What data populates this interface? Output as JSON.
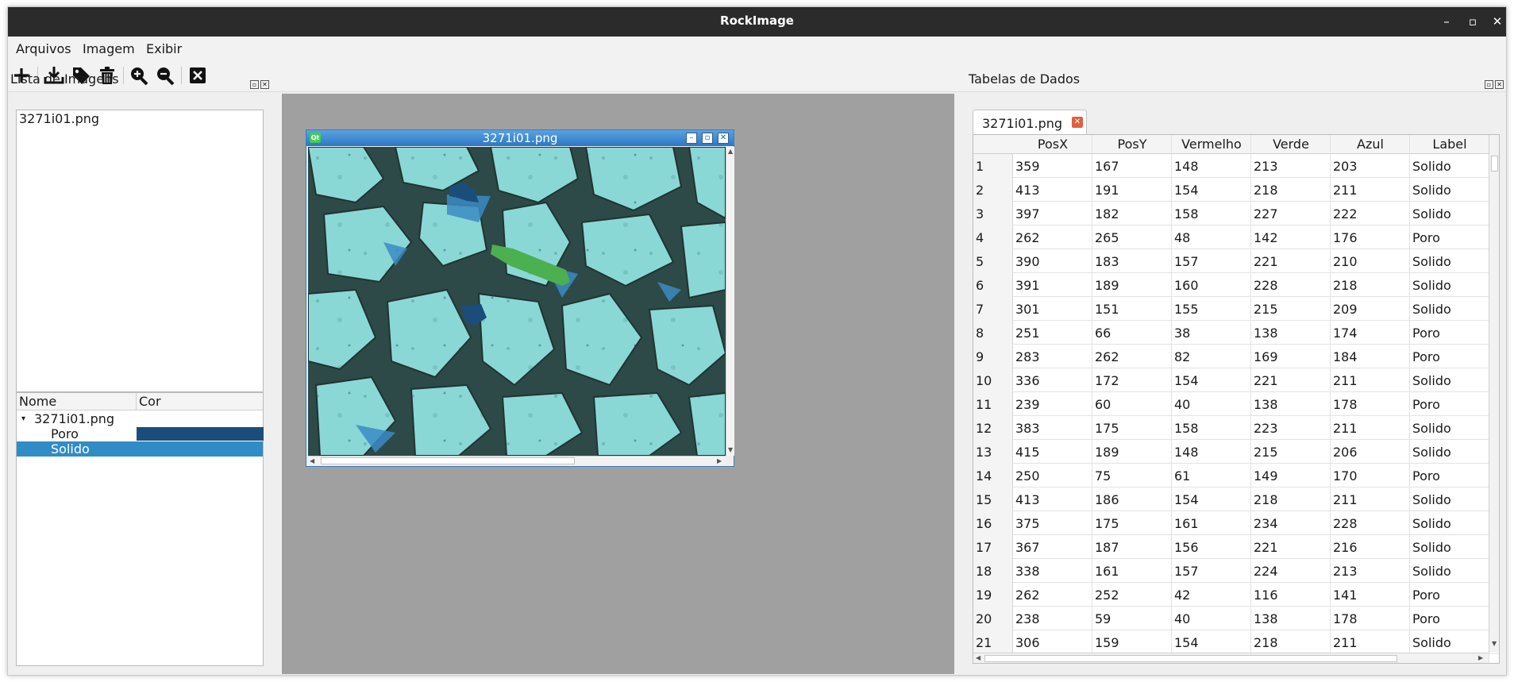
{
  "app": {
    "title": "RockImage",
    "window_controls": {
      "minimize": "–",
      "maximize": "▫",
      "close": "✕"
    }
  },
  "menu": [
    "Arquivos",
    "Imagem",
    "Exibir"
  ],
  "toolbar": {
    "icons": [
      "plus-icon",
      "download-icon",
      "tag-icon",
      "trash-icon",
      "zoom-in-icon",
      "zoom-out-icon",
      "close-icon"
    ]
  },
  "left_panel": {
    "title": "Lista de Imagens",
    "images": [
      "3271i01.png"
    ],
    "tree": {
      "columns": [
        "Nome",
        "Cor"
      ],
      "root": "3271i01.png",
      "children": [
        {
          "name": "Poro",
          "color": "#1a4d7a",
          "selected": false
        },
        {
          "name": "Solido",
          "color": "#308cc6",
          "selected": true
        }
      ]
    }
  },
  "image_window": {
    "title": "3271i01.png",
    "badge": "Qt",
    "annotation_colors": {
      "poro": "#1a4d7a",
      "solido": "#4caf50"
    }
  },
  "right_panel": {
    "title": "Tabelas de Dados",
    "tab": "3271i01.png",
    "columns": [
      "PosX",
      "PosY",
      "Vermelho",
      "Verde",
      "Azul",
      "Label"
    ],
    "rows": [
      [
        "1",
        "359",
        "167",
        "148",
        "213",
        "203",
        "Solido"
      ],
      [
        "2",
        "413",
        "191",
        "154",
        "218",
        "211",
        "Solido"
      ],
      [
        "3",
        "397",
        "182",
        "158",
        "227",
        "222",
        "Solido"
      ],
      [
        "4",
        "262",
        "265",
        "48",
        "142",
        "176",
        "Poro"
      ],
      [
        "5",
        "390",
        "183",
        "157",
        "221",
        "210",
        "Solido"
      ],
      [
        "6",
        "391",
        "189",
        "160",
        "228",
        "218",
        "Solido"
      ],
      [
        "7",
        "301",
        "151",
        "155",
        "215",
        "209",
        "Solido"
      ],
      [
        "8",
        "251",
        "66",
        "38",
        "138",
        "174",
        "Poro"
      ],
      [
        "9",
        "283",
        "262",
        "82",
        "169",
        "184",
        "Poro"
      ],
      [
        "10",
        "336",
        "172",
        "154",
        "221",
        "211",
        "Solido"
      ],
      [
        "11",
        "239",
        "60",
        "40",
        "138",
        "178",
        "Poro"
      ],
      [
        "12",
        "383",
        "175",
        "158",
        "223",
        "211",
        "Solido"
      ],
      [
        "13",
        "415",
        "189",
        "148",
        "215",
        "206",
        "Solido"
      ],
      [
        "14",
        "250",
        "75",
        "61",
        "149",
        "170",
        "Poro"
      ],
      [
        "15",
        "413",
        "186",
        "154",
        "218",
        "211",
        "Solido"
      ],
      [
        "16",
        "375",
        "175",
        "161",
        "234",
        "228",
        "Solido"
      ],
      [
        "17",
        "367",
        "187",
        "156",
        "221",
        "216",
        "Solido"
      ],
      [
        "18",
        "338",
        "161",
        "157",
        "224",
        "213",
        "Solido"
      ],
      [
        "19",
        "262",
        "252",
        "42",
        "116",
        "141",
        "Poro"
      ],
      [
        "20",
        "238",
        "59",
        "40",
        "138",
        "178",
        "Poro"
      ],
      [
        "21",
        "306",
        "159",
        "154",
        "218",
        "211",
        "Solido"
      ]
    ]
  }
}
